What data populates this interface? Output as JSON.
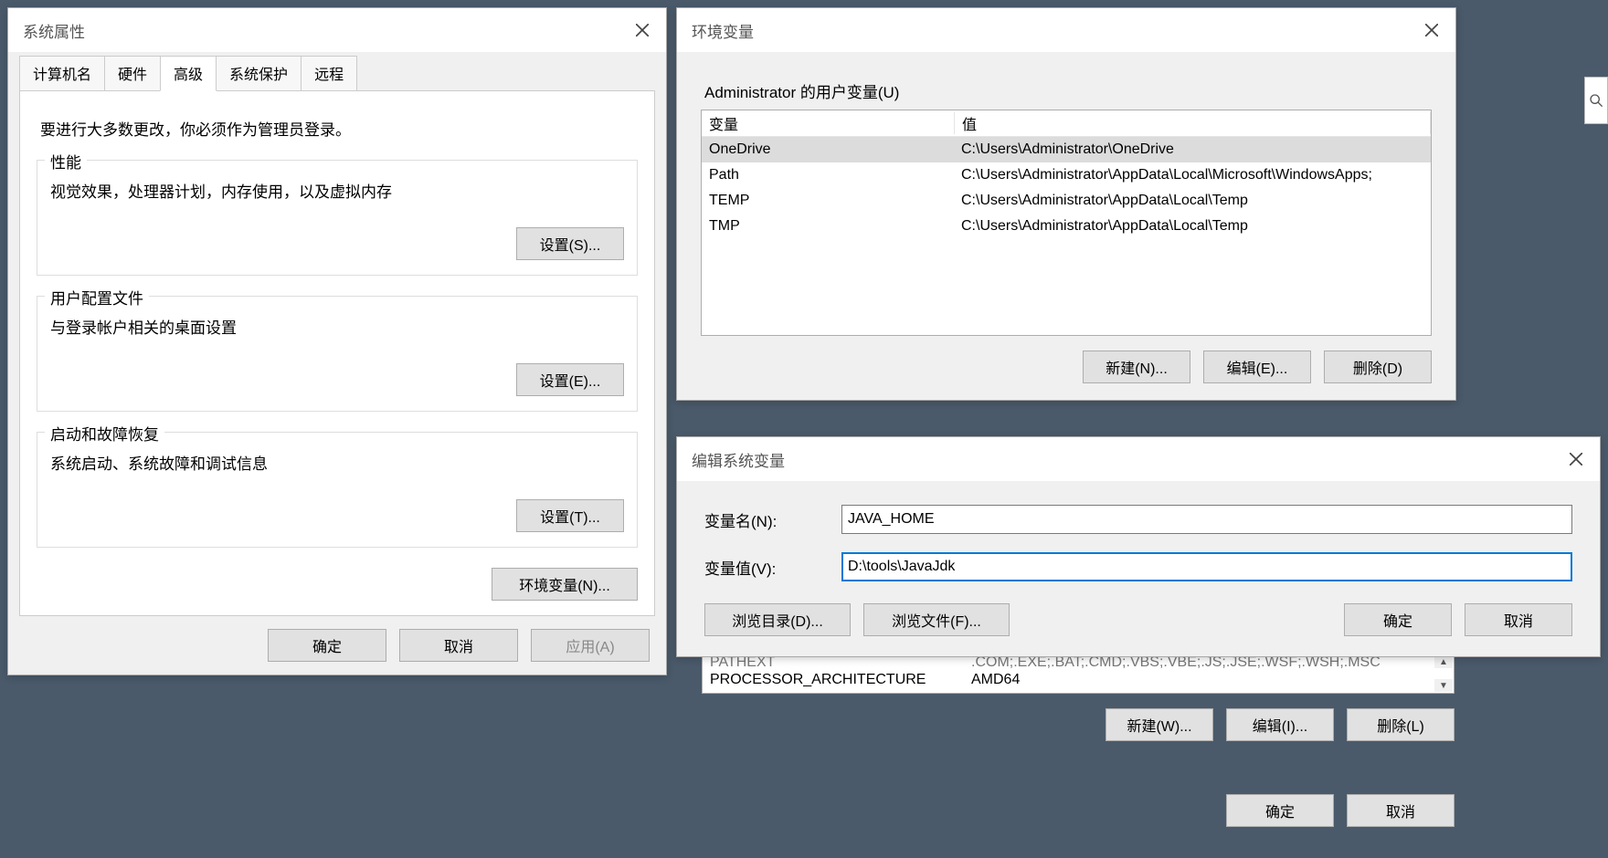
{
  "sysprop": {
    "title": "系统属性",
    "tabs": {
      "computer_name": "计算机名",
      "hardware": "硬件",
      "advanced": "高级",
      "system_protection": "系统保护",
      "remote": "远程"
    },
    "notice": "要进行大多数更改，你必须作为管理员登录。",
    "perf": {
      "title": "性能",
      "desc": "视觉效果，处理器计划，内存使用，以及虚拟内存",
      "button": "设置(S)..."
    },
    "profiles": {
      "title": "用户配置文件",
      "desc": "与登录帐户相关的桌面设置",
      "button": "设置(E)..."
    },
    "startup": {
      "title": "启动和故障恢复",
      "desc": "系统启动、系统故障和调试信息",
      "button": "设置(T)..."
    },
    "env_button": "环境变量(N)...",
    "ok": "确定",
    "cancel": "取消",
    "apply": "应用(A)"
  },
  "envvars": {
    "title": "环境变量",
    "user_section": "Administrator 的用户变量(U)",
    "col_name": "变量",
    "col_value": "值",
    "user_rows": [
      {
        "name": "OneDrive",
        "value": "C:\\Users\\Administrator\\OneDrive"
      },
      {
        "name": "Path",
        "value": "C:\\Users\\Administrator\\AppData\\Local\\Microsoft\\WindowsApps;"
      },
      {
        "name": "TEMP",
        "value": "C:\\Users\\Administrator\\AppData\\Local\\Temp"
      },
      {
        "name": "TMP",
        "value": "C:\\Users\\Administrator\\AppData\\Local\\Temp"
      }
    ],
    "new_u": "新建(N)...",
    "edit_u": "编辑(E)...",
    "del_u": "删除(D)",
    "sys_peek_rows": [
      {
        "name": "PATHEXT",
        "value": ".COM;.EXE;.BAT;.CMD;.VBS;.VBE;.JS;.JSE;.WSF;.WSH;.MSC"
      },
      {
        "name": "PROCESSOR_ARCHITECTURE",
        "value": "AMD64"
      }
    ],
    "new_s": "新建(W)...",
    "edit_s": "编辑(I)...",
    "del_s": "删除(L)",
    "ok": "确定",
    "cancel": "取消"
  },
  "editvar": {
    "title": "编辑系统变量",
    "name_label": "变量名(N):",
    "name_value": "JAVA_HOME",
    "value_label": "变量值(V):",
    "value_value": "D:\\tools\\JavaJdk",
    "browse_dir": "浏览目录(D)...",
    "browse_file": "浏览文件(F)...",
    "ok": "确定",
    "cancel": "取消"
  }
}
